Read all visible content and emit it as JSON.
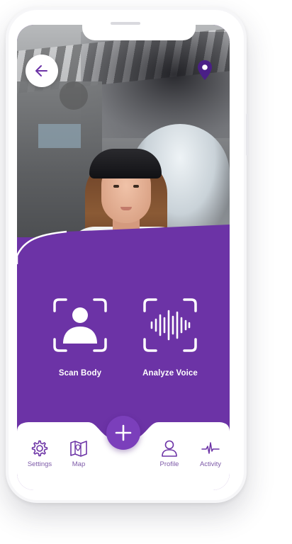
{
  "colors": {
    "accent": "#6c33a6",
    "fab": "#7b3fbb",
    "nav_text": "#7d5aa8",
    "white": "#ffffff"
  },
  "header": {
    "back_icon": "arrow-left-icon",
    "location_icon": "map-pin-icon"
  },
  "actions": [
    {
      "label": "Scan Body",
      "icon": "person-scan-icon"
    },
    {
      "label": "Analyze Voice",
      "icon": "sound-wave-scan-icon"
    }
  ],
  "fab": {
    "icon": "plus-icon"
  },
  "nav": [
    {
      "label": "Settings",
      "icon": "gear-icon"
    },
    {
      "label": "Map",
      "icon": "map-icon"
    },
    {
      "label": "Profile",
      "icon": "user-icon"
    },
    {
      "label": "Activity",
      "icon": "pulse-icon"
    }
  ]
}
